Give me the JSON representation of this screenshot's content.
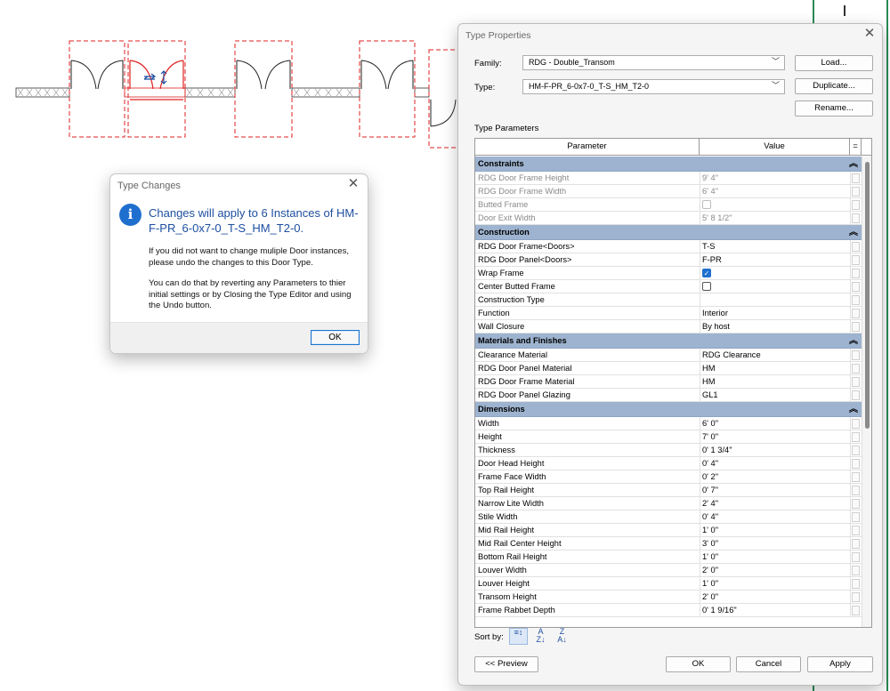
{
  "type_changes": {
    "title": "Type Changes",
    "close_icon": "close-icon",
    "info_icon": "i",
    "heading": "Changes will apply to 6 Instances of HM-F-PR_6-0x7-0_T-S_HM_T2-0.",
    "message1": "If you did not want to change muliple Door instances, please undo the changes to this Door Type.",
    "message2": "You can do that by reverting any Parameters to thier initial settings or by Closing the Type Editor and using the Undo button.",
    "ok_label": "OK"
  },
  "type_properties": {
    "title": "Type Properties",
    "family_label": "Family:",
    "family_value": "RDG - Double_Transom",
    "type_label": "Type:",
    "type_value": "HM-F-PR_6-0x7-0_T-S_HM_T2-0",
    "load_label": "Load...",
    "duplicate_label": "Duplicate...",
    "rename_label": "Rename...",
    "section_label": "Type Parameters",
    "col_parameter": "Parameter",
    "col_value": "Value",
    "col_eq": "=",
    "groups": [
      {
        "name": "Constraints",
        "rows": [
          {
            "name": "RDG Door Frame Height",
            "value": "9'  4\"",
            "readonly": true
          },
          {
            "name": "RDG Door Frame Width",
            "value": "6'  4\"",
            "readonly": true
          },
          {
            "name": "Butted Frame",
            "value": "",
            "checkbox": "disabled",
            "readonly": true
          },
          {
            "name": "Door Exit Width",
            "value": "5'  8 1/2\"",
            "readonly": true
          }
        ]
      },
      {
        "name": "Construction",
        "rows": [
          {
            "name": "RDG Door Frame<Doors>",
            "value": "T-S"
          },
          {
            "name": "RDG Door Panel<Doors>",
            "value": "F-PR"
          },
          {
            "name": "Wrap Frame",
            "value": "",
            "checkbox": "checked"
          },
          {
            "name": "Center Butted Frame",
            "value": "",
            "checkbox": "unchecked"
          },
          {
            "name": "Construction Type",
            "value": ""
          },
          {
            "name": "Function",
            "value": "Interior"
          },
          {
            "name": "Wall Closure",
            "value": "By host"
          }
        ]
      },
      {
        "name": "Materials and Finishes",
        "rows": [
          {
            "name": "Clearance Material",
            "value": "RDG Clearance"
          },
          {
            "name": "RDG Door Panel Material",
            "value": "HM"
          },
          {
            "name": "RDG Door Frame Material",
            "value": "HM"
          },
          {
            "name": "RDG Door Panel Glazing",
            "value": "GL1"
          }
        ]
      },
      {
        "name": "Dimensions",
        "rows": [
          {
            "name": "Width",
            "value": "6'  0\""
          },
          {
            "name": "Height",
            "value": "7'  0\""
          },
          {
            "name": "Thickness",
            "value": "0'  1 3/4\""
          },
          {
            "name": "Door Head Height",
            "value": "0'  4\""
          },
          {
            "name": "Frame Face Width",
            "value": "0'  2\""
          },
          {
            "name": "Top Rail Height",
            "value": "0'  7\""
          },
          {
            "name": "Narrow Lite Width",
            "value": "2'  4\""
          },
          {
            "name": "Stile Width",
            "value": "0'  4\""
          },
          {
            "name": "Mid Rail Height",
            "value": "1'  0\""
          },
          {
            "name": "Mid Rail Center Height",
            "value": "3'  0\""
          },
          {
            "name": "Bottom Rail Height",
            "value": "1'  0\""
          },
          {
            "name": "Louver Width",
            "value": "2'  0\""
          },
          {
            "name": "Louver Height",
            "value": "1'  0\""
          },
          {
            "name": "Transom Height",
            "value": "2'  0\""
          },
          {
            "name": "Frame Rabbet Depth",
            "value": "0'  1 9/16\""
          }
        ]
      }
    ],
    "sort_by_label": "Sort by:",
    "sort_icons": [
      "sort-group-icon",
      "sort-az-icon",
      "sort-za-icon"
    ],
    "preview_label": "<< Preview",
    "ok_label": "OK",
    "cancel_label": "Cancel",
    "apply_label": "Apply"
  },
  "colors": {
    "group_header": "#9db3cf",
    "accent": "#1f6fce",
    "selection_red": "#e02020",
    "heading_blue": "#1e4fa0"
  }
}
